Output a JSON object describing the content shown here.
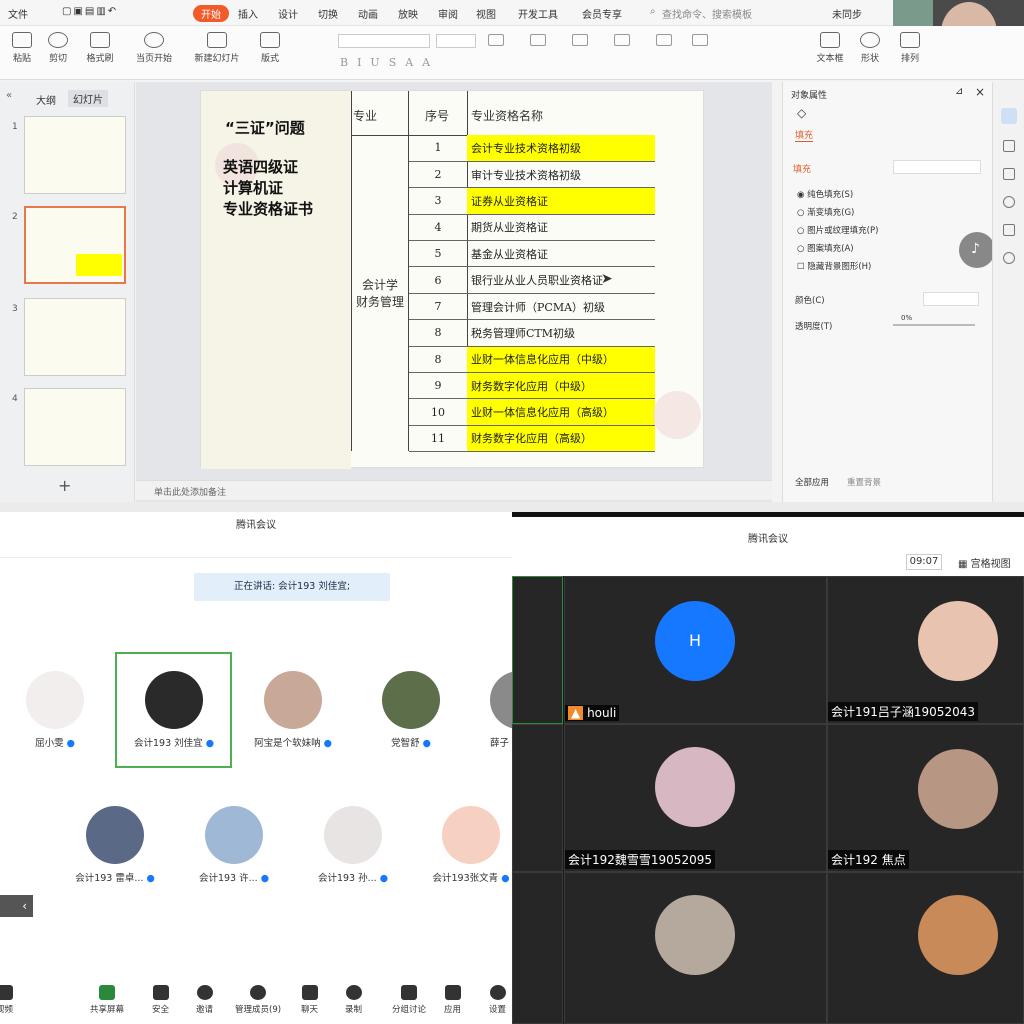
{
  "wps": {
    "menu": [
      "文件",
      "开始",
      "插入",
      "设计",
      "切换",
      "动画",
      "放映",
      "审阅",
      "视图",
      "开发工具",
      "会员专享"
    ],
    "search_placeholder": "查找命令、搜索模板",
    "unsync": "未同步",
    "ribbon": [
      "粘贴",
      "剪切",
      "格式刷",
      "当页开始",
      "新建幻灯片",
      "版式",
      "文本框",
      "形状",
      "排列"
    ],
    "left_tabs": [
      "大纲",
      "幻灯片"
    ],
    "thumbs": [
      "1",
      "2",
      "3",
      "4"
    ],
    "add_slide": "+",
    "notes": "单击此处添加备注",
    "slide": {
      "title": "“三证”问题",
      "lines": [
        "英语四级证",
        "计算机证",
        "专业资格证书"
      ],
      "headers": [
        "专业",
        "序号",
        "专业资格名称"
      ],
      "major": "会计学\n财务管理",
      "rows": [
        {
          "no": "1",
          "name": "会计专业技术资格初级",
          "hl": true
        },
        {
          "no": "2",
          "name": "审计专业技术资格初级",
          "hl": false
        },
        {
          "no": "3",
          "name": "证券从业资格证",
          "hl": true
        },
        {
          "no": "4",
          "name": "期货从业资格证",
          "hl": false
        },
        {
          "no": "5",
          "name": "基金从业资格证",
          "hl": false
        },
        {
          "no": "6",
          "name": "银行业从业人员职业资格证",
          "hl": false
        },
        {
          "no": "7",
          "name": "管理会计师（PCMA）初级",
          "hl": false
        },
        {
          "no": "8",
          "name": "税务管理师CTM初级",
          "hl": false
        },
        {
          "no": "8",
          "name": "业财一体信息化应用（中级）",
          "hl": true
        },
        {
          "no": "9",
          "name": "财务数字化应用（中级）",
          "hl": true
        },
        {
          "no": "10",
          "name": "业财一体信息化应用（高级）",
          "hl": true
        },
        {
          "no": "11",
          "name": "财务数字化应用（高级）",
          "hl": true
        }
      ],
      "highlight_color": "#ffff00"
    },
    "panel": {
      "title": "对象属性",
      "tab": "填充",
      "section": "填充",
      "options": [
        "纯色填充(S)",
        "渐变填充(G)",
        "图片或纹理填充(P)",
        "图案填充(A)",
        "隐藏背景图形(H)"
      ],
      "color_label": "颜色(C)",
      "transparency_label": "透明度(T)",
      "transparency_value": "0%",
      "apply_all": "全部应用",
      "reset_bg": "重置背景"
    }
  },
  "left_meeting": {
    "title": "腾讯会议",
    "speaking": "正在讲话: 会计193 刘佳宜;",
    "row1": [
      "屈小雯",
      "会计193 刘佳宜",
      "阿宝是个软妹呐",
      "党智舒",
      "薛子"
    ],
    "row2": [
      "会计193 雷卓...",
      "会计193 许...",
      "会计193 孙...",
      "会计193张文青"
    ],
    "toolbar": [
      "视频",
      "共享屏幕",
      "安全",
      "邀请",
      "管理成员(9)",
      "聊天",
      "录制",
      "分组讨论",
      "应用",
      "设置"
    ]
  },
  "right_meeting": {
    "title": "腾讯会议",
    "time": "09:07",
    "view": "宫格视图",
    "participants": [
      "houli",
      "会计191吕子涵19052043",
      "会计192魏雪雪19052095",
      "会计192 焦点"
    ],
    "avatar_letter": "H",
    "avatar_color": "#1677ff"
  }
}
